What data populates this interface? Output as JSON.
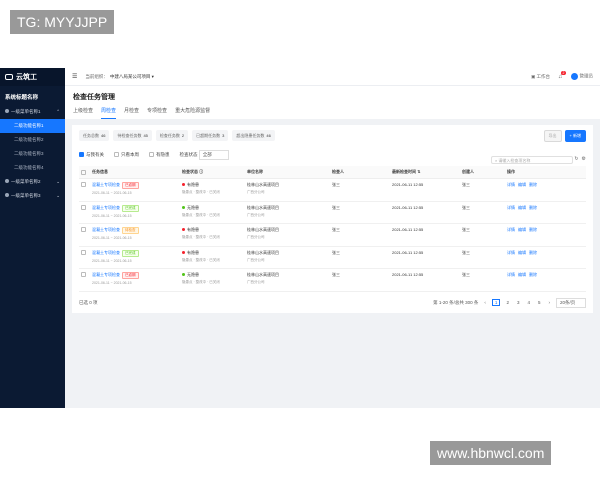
{
  "watermark_top": "TG: MYYJJPP",
  "watermark_bottom": "www.hbnwcl.com",
  "sidebar": {
    "logo": "云筑工",
    "system_name": "系统标题名称",
    "group1": "一级菜单名称1",
    "items": [
      "二级功能名称1",
      "二级功能名称2",
      "二级功能名称3",
      "二级功能名称4"
    ],
    "group2": "一级菜单名称2",
    "group3": "一级菜单名称3"
  },
  "topbar": {
    "crumb": "当前组织：",
    "org": "中建八局某公司项目 ▾",
    "workbench": "工作台",
    "badge": "2",
    "user": "管理员"
  },
  "header": {
    "title": "检查任务管理",
    "tabs": [
      "上级检查",
      "周检查",
      "月检查",
      "专项检查",
      "重大危险源监督"
    ]
  },
  "stats": [
    {
      "label": "任务总数",
      "value": "46"
    },
    {
      "label": "待检查任务数",
      "value": "45"
    },
    {
      "label": "检查任务数",
      "value": "2"
    },
    {
      "label": "已超期任务数",
      "value": "3"
    },
    {
      "label": "超出隐患任务数",
      "value": "46"
    }
  ],
  "actions": {
    "export": "导出",
    "add": "+ 新增"
  },
  "filters": {
    "mine": "与我有关",
    "cycle": "只看本周",
    "hazard": "有隐患",
    "status_label": "检查状态",
    "status_value": "全部"
  },
  "search": {
    "placeholder": "请输入检查项名称"
  },
  "table": {
    "headers": [
      "任务信息",
      "检查状态 ⓘ",
      "单位名称",
      "检查人",
      "最新检查时间 ⇅",
      "创建人",
      "操作"
    ],
    "rows": [
      {
        "name": "混凝土专项检查",
        "tag": "已逾期",
        "tag_color": "red",
        "date": "2021-06-11 ~ 2021-06-15",
        "status": "有隐患",
        "status_color": "red",
        "status_sub": "隐患点 · 整改中 · 已关闭",
        "unit": "桂林山水高速项目",
        "unit_sub": "广西分公司",
        "inspector": "张三",
        "time": "2021-06-11 12:55",
        "creator": "张三"
      },
      {
        "name": "混凝土专项检查",
        "tag": "已完成",
        "tag_color": "green",
        "date": "2021-06-11 ~ 2021-06-15",
        "status": "无隐患",
        "status_color": "green",
        "status_sub": "隐患点 · 整改中 · 已关闭",
        "unit": "桂林山水高速项目",
        "unit_sub": "广西分公司",
        "inspector": "张三",
        "time": "2021-06-11 12:55",
        "creator": "张三"
      },
      {
        "name": "混凝土专项检查",
        "tag": "待检查",
        "tag_color": "orange",
        "date": "2021-06-11 ~ 2021-06-15",
        "status": "有隐患",
        "status_color": "red",
        "status_sub": "隐患点 · 整改中 · 已关闭",
        "unit": "桂林山水高速项目",
        "unit_sub": "广西分公司",
        "inspector": "张三",
        "time": "2021-06-11 12:55",
        "creator": "张三"
      },
      {
        "name": "混凝土专项检查",
        "tag": "已完成",
        "tag_color": "green",
        "date": "2021-06-11 ~ 2021-06-15",
        "status": "有隐患",
        "status_color": "red",
        "status_sub": "隐患点 · 整改中 · 已关闭",
        "unit": "桂林山水高速项目",
        "unit_sub": "广西分公司",
        "inspector": "张三",
        "time": "2021-06-11 12:55",
        "creator": "张三"
      },
      {
        "name": "混凝土专项检查",
        "tag": "已逾期",
        "tag_color": "red",
        "date": "2021-06-11 ~ 2021-06-15",
        "status": "无隐患",
        "status_color": "green",
        "status_sub": "隐患点 · 整改中 · 已关闭",
        "unit": "桂林山水高速项目",
        "unit_sub": "广西分公司",
        "inspector": "张三",
        "time": "2021-06-11 12:55",
        "creator": "张三"
      }
    ],
    "ops": [
      "详情",
      "编辑",
      "删除"
    ]
  },
  "footer": {
    "selected": "已选 0 项",
    "total": "第 1-20 条/总共 300 条",
    "pages": [
      "1",
      "2",
      "3",
      "4",
      "5"
    ],
    "page_size": "20条/页"
  }
}
